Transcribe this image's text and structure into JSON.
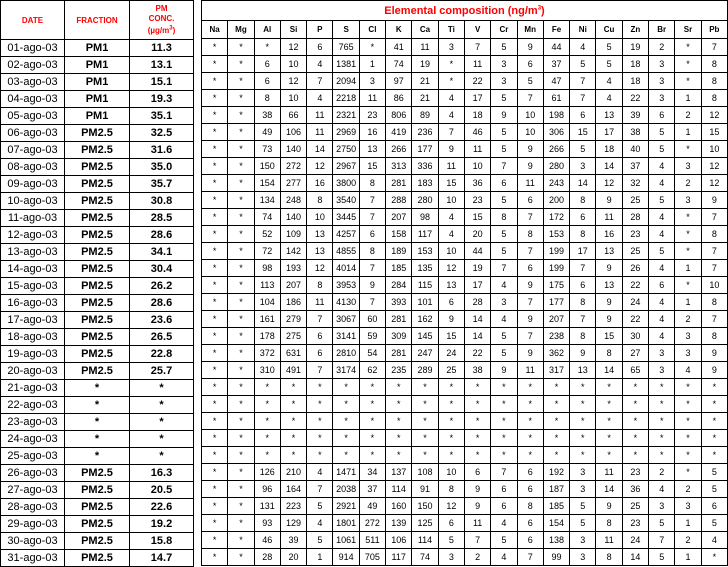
{
  "headers": {
    "date": "DATE",
    "fraction": "FRACTION",
    "pm_line1": "PM",
    "pm_line2": "CONC.",
    "pm_unit_a": "(µg/m",
    "pm_unit_sup": "3",
    "pm_unit_b": ")",
    "title_a": "Elemental composition (ng/m",
    "title_sup": "3",
    "title_b": ")"
  },
  "elements": [
    "Na",
    "Mg",
    "Al",
    "Si",
    "P",
    "S",
    "Cl",
    "K",
    "Ca",
    "Ti",
    "V",
    "Cr",
    "Mn",
    "Fe",
    "Ni",
    "Cu",
    "Zn",
    "Br",
    "Sr",
    "Pb"
  ],
  "rows": [
    {
      "date": "01-ago-03",
      "fraction": "PM1",
      "pm": "11.3",
      "values": [
        "*",
        "*",
        "*",
        "12",
        "6",
        "765",
        "*",
        "41",
        "11",
        "3",
        "7",
        "5",
        "9",
        "44",
        "4",
        "5",
        "19",
        "2",
        "*",
        "7"
      ]
    },
    {
      "date": "02-ago-03",
      "fraction": "PM1",
      "pm": "13.1",
      "values": [
        "*",
        "*",
        "6",
        "10",
        "4",
        "1381",
        "1",
        "74",
        "19",
        "*",
        "11",
        "3",
        "6",
        "37",
        "5",
        "5",
        "18",
        "3",
        "*",
        "8"
      ]
    },
    {
      "date": "03-ago-03",
      "fraction": "PM1",
      "pm": "15.1",
      "values": [
        "*",
        "*",
        "6",
        "12",
        "7",
        "2094",
        "3",
        "97",
        "21",
        "*",
        "22",
        "3",
        "5",
        "47",
        "7",
        "4",
        "18",
        "3",
        "*",
        "8"
      ]
    },
    {
      "date": "04-ago-03",
      "fraction": "PM1",
      "pm": "19.3",
      "values": [
        "*",
        "*",
        "8",
        "10",
        "4",
        "2218",
        "11",
        "86",
        "21",
        "4",
        "17",
        "5",
        "7",
        "61",
        "7",
        "4",
        "22",
        "3",
        "1",
        "8"
      ]
    },
    {
      "date": "05-ago-03",
      "fraction": "PM1",
      "pm": "35.1",
      "values": [
        "*",
        "*",
        "38",
        "66",
        "11",
        "2321",
        "23",
        "806",
        "89",
        "4",
        "18",
        "9",
        "10",
        "198",
        "6",
        "13",
        "39",
        "6",
        "2",
        "12"
      ]
    },
    {
      "date": "06-ago-03",
      "fraction": "PM2.5",
      "pm": "32.5",
      "values": [
        "*",
        "*",
        "49",
        "106",
        "11",
        "2969",
        "16",
        "419",
        "236",
        "7",
        "46",
        "5",
        "10",
        "306",
        "15",
        "17",
        "38",
        "5",
        "1",
        "15"
      ]
    },
    {
      "date": "07-ago-03",
      "fraction": "PM2.5",
      "pm": "31.6",
      "values": [
        "*",
        "*",
        "73",
        "140",
        "14",
        "2750",
        "13",
        "266",
        "177",
        "9",
        "11",
        "5",
        "9",
        "266",
        "5",
        "18",
        "40",
        "5",
        "*",
        "10"
      ]
    },
    {
      "date": "08-ago-03",
      "fraction": "PM2.5",
      "pm": "35.0",
      "values": [
        "*",
        "*",
        "150",
        "272",
        "12",
        "2967",
        "15",
        "313",
        "336",
        "11",
        "10",
        "7",
        "9",
        "280",
        "3",
        "14",
        "37",
        "4",
        "3",
        "12"
      ]
    },
    {
      "date": "09-ago-03",
      "fraction": "PM2.5",
      "pm": "35.7",
      "values": [
        "*",
        "*",
        "154",
        "277",
        "16",
        "3800",
        "8",
        "281",
        "183",
        "15",
        "36",
        "6",
        "11",
        "243",
        "14",
        "12",
        "32",
        "4",
        "2",
        "12"
      ]
    },
    {
      "date": "10-ago-03",
      "fraction": "PM2.5",
      "pm": "30.8",
      "values": [
        "*",
        "*",
        "134",
        "248",
        "8",
        "3540",
        "7",
        "288",
        "280",
        "10",
        "23",
        "5",
        "6",
        "200",
        "8",
        "9",
        "25",
        "5",
        "3",
        "9"
      ]
    },
    {
      "date": "11-ago-03",
      "fraction": "PM2.5",
      "pm": "28.5",
      "values": [
        "*",
        "*",
        "74",
        "140",
        "10",
        "3445",
        "7",
        "207",
        "98",
        "4",
        "15",
        "8",
        "7",
        "172",
        "6",
        "11",
        "28",
        "4",
        "*",
        "7"
      ]
    },
    {
      "date": "12-ago-03",
      "fraction": "PM2.5",
      "pm": "28.6",
      "values": [
        "*",
        "*",
        "52",
        "109",
        "13",
        "4257",
        "6",
        "158",
        "117",
        "4",
        "20",
        "5",
        "8",
        "153",
        "8",
        "16",
        "23",
        "4",
        "*",
        "8"
      ]
    },
    {
      "date": "13-ago-03",
      "fraction": "PM2.5",
      "pm": "34.1",
      "values": [
        "*",
        "*",
        "72",
        "142",
        "13",
        "4855",
        "8",
        "189",
        "153",
        "10",
        "44",
        "5",
        "7",
        "199",
        "17",
        "13",
        "25",
        "5",
        "*",
        "7"
      ]
    },
    {
      "date": "14-ago-03",
      "fraction": "PM2.5",
      "pm": "30.4",
      "values": [
        "*",
        "*",
        "98",
        "193",
        "12",
        "4014",
        "7",
        "185",
        "135",
        "12",
        "19",
        "7",
        "6",
        "199",
        "7",
        "9",
        "26",
        "4",
        "1",
        "7"
      ]
    },
    {
      "date": "15-ago-03",
      "fraction": "PM2.5",
      "pm": "26.2",
      "values": [
        "*",
        "*",
        "113",
        "207",
        "8",
        "3953",
        "9",
        "284",
        "115",
        "13",
        "17",
        "4",
        "9",
        "175",
        "6",
        "13",
        "22",
        "6",
        "*",
        "10"
      ]
    },
    {
      "date": "16-ago-03",
      "fraction": "PM2.5",
      "pm": "28.6",
      "values": [
        "*",
        "*",
        "104",
        "186",
        "11",
        "4130",
        "7",
        "393",
        "101",
        "6",
        "28",
        "3",
        "7",
        "177",
        "8",
        "9",
        "24",
        "4",
        "1",
        "8"
      ]
    },
    {
      "date": "17-ago-03",
      "fraction": "PM2.5",
      "pm": "23.6",
      "values": [
        "*",
        "*",
        "161",
        "279",
        "7",
        "3067",
        "60",
        "281",
        "162",
        "9",
        "14",
        "4",
        "9",
        "207",
        "7",
        "9",
        "22",
        "4",
        "2",
        "7"
      ]
    },
    {
      "date": "18-ago-03",
      "fraction": "PM2.5",
      "pm": "26.5",
      "values": [
        "*",
        "*",
        "178",
        "275",
        "6",
        "3141",
        "59",
        "309",
        "145",
        "15",
        "14",
        "5",
        "7",
        "238",
        "8",
        "15",
        "30",
        "4",
        "3",
        "8"
      ]
    },
    {
      "date": "19-ago-03",
      "fraction": "PM2.5",
      "pm": "22.8",
      "values": [
        "*",
        "*",
        "372",
        "631",
        "6",
        "2810",
        "54",
        "281",
        "247",
        "24",
        "22",
        "5",
        "9",
        "362",
        "9",
        "8",
        "27",
        "3",
        "3",
        "9"
      ]
    },
    {
      "date": "20-ago-03",
      "fraction": "PM2.5",
      "pm": "25.7",
      "values": [
        "*",
        "*",
        "310",
        "491",
        "7",
        "3174",
        "62",
        "235",
        "289",
        "25",
        "38",
        "9",
        "11",
        "317",
        "13",
        "14",
        "65",
        "3",
        "4",
        "9"
      ]
    },
    {
      "date": "21-ago-03",
      "fraction": "*",
      "pm": "*",
      "values": [
        "*",
        "*",
        "*",
        "*",
        "*",
        "*",
        "*",
        "*",
        "*",
        "*",
        "*",
        "*",
        "*",
        "*",
        "*",
        "*",
        "*",
        "*",
        "*",
        "*"
      ]
    },
    {
      "date": "22-ago-03",
      "fraction": "*",
      "pm": "*",
      "values": [
        "*",
        "*",
        "*",
        "*",
        "*",
        "*",
        "*",
        "*",
        "*",
        "*",
        "*",
        "*",
        "*",
        "*",
        "*",
        "*",
        "*",
        "*",
        "*",
        "*"
      ]
    },
    {
      "date": "23-ago-03",
      "fraction": "*",
      "pm": "*",
      "values": [
        "*",
        "*",
        "*",
        "*",
        "*",
        "*",
        "*",
        "*",
        "*",
        "*",
        "*",
        "*",
        "*",
        "*",
        "*",
        "*",
        "*",
        "*",
        "*",
        "*"
      ]
    },
    {
      "date": "24-ago-03",
      "fraction": "*",
      "pm": "*",
      "values": [
        "*",
        "*",
        "*",
        "*",
        "*",
        "*",
        "*",
        "*",
        "*",
        "*",
        "*",
        "*",
        "*",
        "*",
        "*",
        "*",
        "*",
        "*",
        "*",
        "*"
      ]
    },
    {
      "date": "25-ago-03",
      "fraction": "*",
      "pm": "*",
      "values": [
        "*",
        "*",
        "*",
        "*",
        "*",
        "*",
        "*",
        "*",
        "*",
        "*",
        "*",
        "*",
        "*",
        "*",
        "*",
        "*",
        "*",
        "*",
        "*",
        "*"
      ]
    },
    {
      "date": "26-ago-03",
      "fraction": "PM2.5",
      "pm": "16.3",
      "values": [
        "*",
        "*",
        "126",
        "210",
        "4",
        "1471",
        "34",
        "137",
        "108",
        "10",
        "6",
        "7",
        "6",
        "192",
        "3",
        "11",
        "23",
        "2",
        "*",
        "5"
      ]
    },
    {
      "date": "27-ago-03",
      "fraction": "PM2.5",
      "pm": "20.5",
      "values": [
        "*",
        "*",
        "96",
        "164",
        "7",
        "2038",
        "37",
        "114",
        "91",
        "8",
        "9",
        "6",
        "6",
        "187",
        "3",
        "14",
        "36",
        "4",
        "2",
        "5"
      ]
    },
    {
      "date": "28-ago-03",
      "fraction": "PM2.5",
      "pm": "22.6",
      "values": [
        "*",
        "*",
        "131",
        "223",
        "5",
        "2921",
        "49",
        "160",
        "150",
        "12",
        "9",
        "6",
        "8",
        "185",
        "5",
        "9",
        "25",
        "3",
        "3",
        "6"
      ]
    },
    {
      "date": "29-ago-03",
      "fraction": "PM2.5",
      "pm": "19.2",
      "values": [
        "*",
        "*",
        "93",
        "129",
        "4",
        "1801",
        "272",
        "139",
        "125",
        "6",
        "11",
        "4",
        "6",
        "154",
        "5",
        "8",
        "23",
        "5",
        "1",
        "5"
      ]
    },
    {
      "date": "30-ago-03",
      "fraction": "PM2.5",
      "pm": "15.8",
      "values": [
        "*",
        "*",
        "46",
        "39",
        "5",
        "1061",
        "511",
        "106",
        "114",
        "5",
        "7",
        "5",
        "6",
        "138",
        "3",
        "11",
        "24",
        "7",
        "2",
        "4"
      ]
    },
    {
      "date": "31-ago-03",
      "fraction": "PM2.5",
      "pm": "14.7",
      "values": [
        "*",
        "*",
        "28",
        "20",
        "1",
        "914",
        "705",
        "117",
        "74",
        "3",
        "2",
        "4",
        "7",
        "99",
        "3",
        "8",
        "14",
        "5",
        "1",
        "*"
      ]
    }
  ]
}
